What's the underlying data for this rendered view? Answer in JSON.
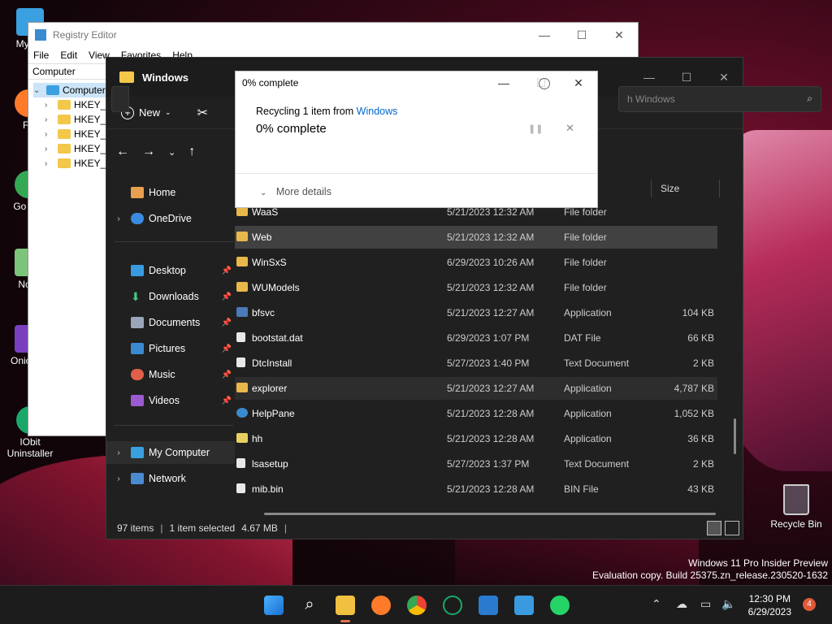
{
  "desktop": {
    "icons": [
      {
        "label": "My Co"
      },
      {
        "label": "Fir"
      },
      {
        "label": "Go Chi"
      },
      {
        "label": "Note"
      },
      {
        "label": "Onio Co"
      },
      {
        "label": "IObit Uninstaller"
      }
    ],
    "recycle_bin": "Recycle Bin",
    "watermark_line1": "Windows 11 Pro Insider Preview",
    "watermark_line2": "Evaluation copy. Build 25375.zn_release.230520-1632"
  },
  "regedit": {
    "title": "Registry Editor",
    "menu": [
      "File",
      "Edit",
      "View",
      "Favorites",
      "Help"
    ],
    "path": "Computer",
    "root": "Computer",
    "keys": [
      "HKEY_C",
      "HKEY_C",
      "HKEY_L",
      "HKEY_U",
      "HKEY_C"
    ]
  },
  "explorer": {
    "title": "Windows",
    "new_label": "New",
    "search_placeholder": "h Windows",
    "size_header": "Size",
    "nav": {
      "home": "Home",
      "onedrive": "OneDrive",
      "desktop": "Desktop",
      "downloads": "Downloads",
      "documents": "Documents",
      "pictures": "Pictures",
      "music": "Music",
      "videos": "Videos",
      "mycomputer": "My Computer",
      "network": "Network"
    },
    "files": [
      {
        "name": "WaaS",
        "date": "5/21/2023 12:32 AM",
        "type": "File folder",
        "size": ""
      },
      {
        "name": "Web",
        "date": "5/21/2023 12:32 AM",
        "type": "File folder",
        "size": ""
      },
      {
        "name": "WinSxS",
        "date": "6/29/2023 10:26 AM",
        "type": "File folder",
        "size": ""
      },
      {
        "name": "WUModels",
        "date": "5/21/2023 12:32 AM",
        "type": "File folder",
        "size": ""
      },
      {
        "name": "bfsvc",
        "date": "5/21/2023 12:27 AM",
        "type": "Application",
        "size": "104 KB"
      },
      {
        "name": "bootstat.dat",
        "date": "6/29/2023 1:07 PM",
        "type": "DAT File",
        "size": "66 KB"
      },
      {
        "name": "DtcInstall",
        "date": "5/27/2023 1:40 PM",
        "type": "Text Document",
        "size": "2 KB"
      },
      {
        "name": "explorer",
        "date": "5/21/2023 12:27 AM",
        "type": "Application",
        "size": "4,787 KB"
      },
      {
        "name": "HelpPane",
        "date": "5/21/2023 12:28 AM",
        "type": "Application",
        "size": "1,052 KB"
      },
      {
        "name": "hh",
        "date": "5/21/2023 12:28 AM",
        "type": "Application",
        "size": "36 KB"
      },
      {
        "name": "lsasetup",
        "date": "5/27/2023 1:37 PM",
        "type": "Text Document",
        "size": "2 KB"
      },
      {
        "name": "mib.bin",
        "date": "5/21/2023 12:28 AM",
        "type": "BIN File",
        "size": "43 KB"
      }
    ],
    "status": {
      "items": "97 items",
      "selected": "1 item selected",
      "size": "4.67 MB"
    }
  },
  "progress": {
    "title": "0% complete",
    "recycling": "Recycling 1 item from",
    "source": "Windows",
    "percent": "0% complete",
    "more_details": "More details"
  },
  "taskbar": {
    "time": "12:30 PM",
    "date": "6/29/2023",
    "notifications": "4"
  },
  "colors": {
    "explorer_bg": "#202020",
    "selection": "#414141",
    "link": "#0066cc",
    "accent_indicator": "#e07050",
    "notif_badge": "#e05a3a"
  }
}
